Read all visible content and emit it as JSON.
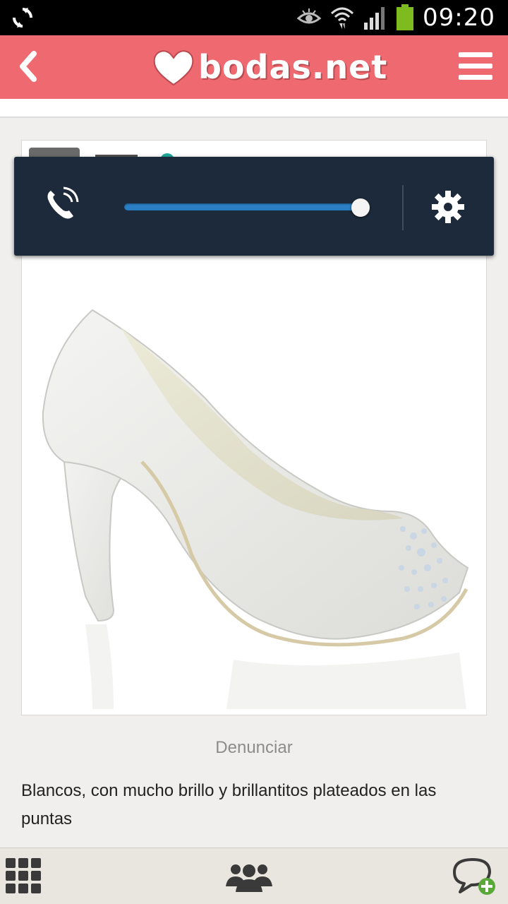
{
  "status_bar": {
    "time": "09:20",
    "icons": [
      "sync-icon",
      "eye-icon",
      "wifi-icon",
      "signal-icon",
      "battery-icon"
    ],
    "battery_color": "#7dbb1f"
  },
  "app_bar": {
    "logo_text": "bodas.net",
    "background_color": "#ef6a70"
  },
  "post": {
    "report_label": "Denunciar",
    "caption": "Blancos, con mucho brillo y brillantitos plateados en las puntas"
  },
  "volume_panel": {
    "level": 1.0,
    "background_color": "#1c2a3b",
    "track_color": "#2a7fc4"
  },
  "bottom_nav": {
    "icons": [
      "grid-menu-icon",
      "group-icon",
      "new-chat-icon"
    ]
  }
}
